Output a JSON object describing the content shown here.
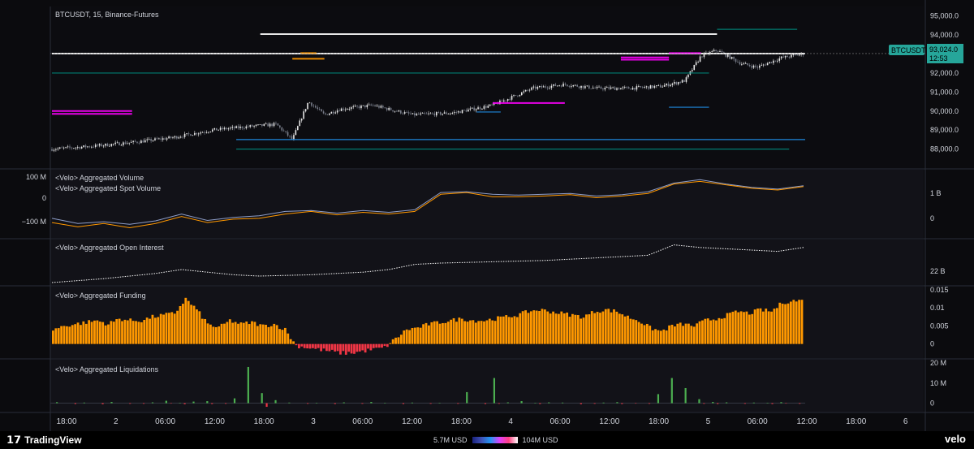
{
  "header": {
    "symbol": "BTCUSDT, 15, Binance-Futures"
  },
  "price_tag": {
    "symbol": "BTCUSDT",
    "price": "93,024.0",
    "countdown": "12:53",
    "color": "#26a69a"
  },
  "footer": {
    "brand": "TradingView",
    "heatmap_min": "5.7M USD",
    "heatmap_max": "104M USD",
    "velo": "velo"
  },
  "chart_data": [
    {
      "type": "candlestick",
      "title": "BTCUSDT, 15, Binance-Futures",
      "x_axis_ticks": [
        "18:00",
        "2",
        "06:00",
        "12:00",
        "18:00",
        "3",
        "06:00",
        "12:00",
        "18:00",
        "4",
        "06:00",
        "12:00",
        "18:00",
        "5",
        "06:00",
        "12:00",
        "18:00",
        "6"
      ],
      "y_ticks": [
        "95,000.0",
        "94,000.0",
        "93,000.0",
        "92,000.0",
        "91,000.0",
        "90,000.0",
        "89,000.0",
        "88,000.0"
      ],
      "ylim": [
        87000,
        95500
      ],
      "last_price": 93024.0,
      "approx_close_path": [
        [
          0,
          88000
        ],
        [
          5,
          88150
        ],
        [
          10,
          88350
        ],
        [
          15,
          88600
        ],
        [
          20,
          89000
        ],
        [
          25,
          89200
        ],
        [
          28,
          89300
        ],
        [
          30,
          88500
        ],
        [
          32,
          90500
        ],
        [
          34,
          89800
        ],
        [
          36,
          90100
        ],
        [
          40,
          90300
        ],
        [
          45,
          89800
        ],
        [
          50,
          89900
        ],
        [
          55,
          90300
        ],
        [
          60,
          91200
        ],
        [
          64,
          91400
        ],
        [
          68,
          91200
        ],
        [
          72,
          91200
        ],
        [
          76,
          91300
        ],
        [
          79,
          91600
        ],
        [
          81,
          92900
        ],
        [
          83,
          93200
        ],
        [
          86,
          92500
        ],
        [
          88,
          92300
        ],
        [
          91,
          92800
        ],
        [
          94,
          93024
        ]
      ],
      "levels": [
        {
          "price": 94050,
          "from": 26,
          "to": 83,
          "color": "#ffffff"
        },
        {
          "price": 93020,
          "from": 0,
          "to": 94,
          "color": "#ffffff"
        },
        {
          "price": 90000,
          "from": 0,
          "to": 10,
          "color": "#ff00ff"
        },
        {
          "price": 89850,
          "from": 0,
          "to": 10,
          "color": "#ff00ff"
        },
        {
          "price": 90420,
          "from": 55,
          "to": 64,
          "color": "#ff00ff"
        },
        {
          "price": 92820,
          "from": 71,
          "to": 77,
          "color": "#ff00ff"
        },
        {
          "price": 92700,
          "from": 71,
          "to": 77,
          "color": "#ff00ff"
        },
        {
          "price": 93050,
          "from": 77,
          "to": 81,
          "color": "#ff00ff"
        },
        {
          "price": 92750,
          "from": 30,
          "to": 34,
          "color": "#ff9800"
        },
        {
          "price": 93050,
          "from": 31,
          "to": 33,
          "color": "#ff9800"
        },
        {
          "price": 88500,
          "from": 23,
          "to": 94,
          "color": "#2196f3"
        },
        {
          "price": 88000,
          "from": 23,
          "to": 92,
          "color": "#00897b"
        },
        {
          "price": 92000,
          "from": 0,
          "to": 82,
          "color": "#00897b"
        },
        {
          "price": 90200,
          "from": 77,
          "to": 82,
          "color": "#2196f3"
        },
        {
          "price": 89950,
          "from": 53,
          "to": 56,
          "color": "#2196f3"
        },
        {
          "price": 94300,
          "from": 83,
          "to": 93,
          "color": "#00897b"
        }
      ]
    },
    {
      "type": "line",
      "title": "<Velo> Aggregated Volume",
      "subtitle": "<Velo> Aggregated Spot Volume",
      "left_ticks": [
        "100 M",
        "0",
        "−100 M"
      ],
      "right_ticks": [
        "1 B",
        "0"
      ],
      "series": [
        {
          "name": "<Velo> Aggregated Volume",
          "color": "#8e9ec9",
          "values": [
            0,
            -12,
            -8,
            -14,
            -6,
            10,
            -5,
            2,
            6,
            16,
            18,
            12,
            18,
            14,
            20,
            60,
            62,
            56,
            54,
            56,
            58,
            52,
            55,
            62,
            82,
            90,
            80,
            72,
            68,
            76
          ]
        },
        {
          "name": "<Velo> Aggregated Spot Volume",
          "color": "#ff9800",
          "values": [
            -10,
            -20,
            -12,
            -22,
            -12,
            4,
            -10,
            -2,
            0,
            10,
            16,
            8,
            14,
            10,
            16,
            56,
            60,
            50,
            50,
            52,
            55,
            48,
            52,
            58,
            80,
            86,
            78,
            70,
            66,
            74
          ]
        }
      ]
    },
    {
      "type": "line",
      "title": "<Velo> Aggregated Open Interest",
      "right_ticks": [
        "22 B"
      ],
      "series": [
        {
          "name": "<Velo> Aggregated Open Interest",
          "color": "#ffffff",
          "values": [
            0,
            3,
            6,
            10,
            14,
            20,
            16,
            12,
            10,
            11,
            12,
            14,
            16,
            20,
            28,
            30,
            31,
            32,
            33,
            34,
            36,
            38,
            40,
            42,
            58,
            54,
            52,
            50,
            48,
            54
          ]
        }
      ]
    },
    {
      "type": "bar",
      "title": "<Velo> Aggregated Funding",
      "right_ticks": [
        "0.015",
        "0.01",
        "0.005",
        "0"
      ],
      "ylim": [
        -0.003,
        0.015
      ],
      "series": [
        {
          "name": "<Velo> Aggregated Funding",
          "positive_color": "#ff9800",
          "negative_color": "#f23645",
          "values": [
            0.004,
            0.005,
            0.0055,
            0.006,
            0.0065,
            0.0055,
            0.007,
            0.0065,
            0.0065,
            0.0075,
            0.008,
            0.0085,
            0.0125,
            0.0095,
            0.0055,
            0.0045,
            0.0065,
            0.0055,
            0.006,
            0.005,
            0.0055,
            0.004,
            -0.0005,
            -0.001,
            -0.0015,
            -0.002,
            -0.0025,
            -0.0025,
            -0.002,
            -0.0015,
            -0.001,
            0.0015,
            0.004,
            0.0045,
            0.0055,
            0.006,
            0.0065,
            0.007,
            0.0065,
            0.0065,
            0.007,
            0.0075,
            0.008,
            0.009,
            0.0095,
            0.009,
            0.0085,
            0.008,
            0.0075,
            0.009,
            0.0095,
            0.009,
            0.0075,
            0.0065,
            0.0045,
            0.0035,
            0.005,
            0.0055,
            0.005,
            0.0065,
            0.007,
            0.008,
            0.009,
            0.0085,
            0.0095,
            0.009,
            0.0115,
            0.012
          ]
        }
      ]
    },
    {
      "type": "bar",
      "title": "<Velo> Aggregated Liquidations",
      "right_ticks": [
        "20 M",
        "10 M",
        "0"
      ],
      "ylim": [
        -3,
        20
      ],
      "series": [
        {
          "name": "longs",
          "color": "#4caf50",
          "values": [
            0.5,
            0,
            0.3,
            0,
            0.6,
            0,
            0,
            0.4,
            1.2,
            0.2,
            0.8,
            1.0,
            0,
            2.4,
            18.0,
            5.0,
            1.5,
            0.3,
            0,
            0.2,
            0,
            0.4,
            0,
            0.6,
            0.2,
            0,
            0.3,
            0,
            0.2,
            0,
            5.5,
            0,
            12.5,
            0.4,
            1.0,
            0.2,
            0.4,
            0.3,
            0,
            0,
            0.3,
            0.5,
            0,
            0,
            4.5,
            12.5,
            7.5,
            2.0,
            0.6,
            0.4,
            0,
            0.3,
            0.2,
            0.5,
            0
          ]
        },
        {
          "name": "shorts",
          "color": "#f23645",
          "values": [
            0,
            0.4,
            0,
            0.5,
            0,
            0.3,
            0.3,
            0,
            0.2,
            0.5,
            0,
            0.4,
            0.3,
            0,
            0,
            1.8,
            0,
            0,
            0.3,
            0,
            0.4,
            0,
            0.3,
            0,
            0,
            0.4,
            0,
            0.3,
            0,
            0.3,
            0,
            0.4,
            0.3,
            0,
            0,
            0.4,
            0,
            0,
            0.5,
            0.3,
            0,
            0.4,
            0.2,
            0.3,
            0,
            0,
            0,
            0.3,
            0.4,
            0,
            0.3,
            0,
            0.4,
            0.2,
            0.3
          ]
        }
      ]
    }
  ]
}
